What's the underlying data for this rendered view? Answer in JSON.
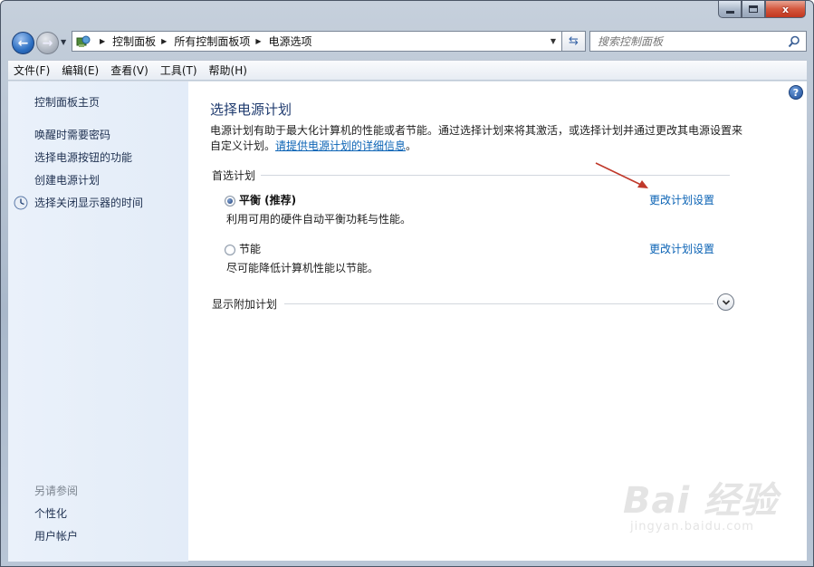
{
  "window": {
    "caption": {
      "minimize": "",
      "maximize": "",
      "close": "x"
    }
  },
  "navbar": {
    "breadcrumbs": [
      "控制面板",
      "所有控制面板项",
      "电源选项"
    ],
    "search_placeholder": "搜索控制面板"
  },
  "menubar": {
    "items": [
      "文件(F)",
      "编辑(E)",
      "查看(V)",
      "工具(T)",
      "帮助(H)"
    ]
  },
  "sidebar": {
    "home": "控制面板主页",
    "links": [
      "唤醒时需要密码",
      "选择电源按钮的功能",
      "创建电源计划",
      "选择关闭显示器的时间"
    ],
    "see_also_title": "另请参阅",
    "see_also": [
      "个性化",
      "用户帐户"
    ]
  },
  "main": {
    "title": "选择电源计划",
    "description": "电源计划有助于最大化计算机的性能或者节能。通过选择计划来将其激活，或选择计划并通过更改其电源设置来自定义计划。",
    "description_link": "请提供电源计划的详细信息",
    "description_end": "。",
    "preferred_group": "首选计划",
    "plans": [
      {
        "name": "平衡 (推荐)",
        "desc": "利用可用的硬件自动平衡功耗与性能。",
        "link": "更改计划设置",
        "selected": true
      },
      {
        "name": "节能",
        "desc": "尽可能降低计算机性能以节能。",
        "link": "更改计划设置",
        "selected": false
      }
    ],
    "additional_group": "显示附加计划",
    "help": "?"
  },
  "watermark": {
    "big": "Bai 经验",
    "small": "jingyan.baidu.com"
  },
  "colors": {
    "link": "#0b63b5",
    "title": "#1e3a6e",
    "sidebar_bg": "#e3ecf8",
    "arrow": "#c0392b"
  }
}
